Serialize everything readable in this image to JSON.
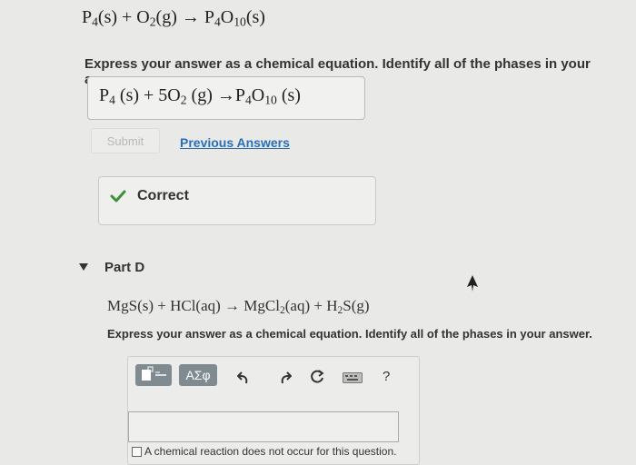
{
  "top_equation": {
    "p4": "P",
    "sub4": "4",
    "rest1": "(s) + O",
    "sub2": "2",
    "rest2": "(g) → P",
    "sub4b": "4",
    "o": "O",
    "sub10": "10",
    "rest3": "(s)"
  },
  "instruction_top": "Express your answer as a chemical equation. Identify all of the phases in your answer.",
  "answer": {
    "a1": "P",
    "s1": "4",
    "a2": " (s) + 5O",
    "s2": "2",
    "a3": " (g) →P",
    "s3": "4",
    "a4": "O",
    "s4": "10",
    "a5": " (s)"
  },
  "submit_label": "Submit",
  "previous_answers_label": "Previous Answers",
  "correct_label": "Correct",
  "part_d_label": "Part D",
  "equation_d": {
    "d1": "MgS(s) + HCl(aq) → MgCl",
    "ds1": "2",
    "d2": "(aq) + H",
    "ds2": "2",
    "d3": "S(g)"
  },
  "instruction_d": "Express your answer as a chemical equation. Identify all of the phases in your answer.",
  "toolbar": {
    "greek_label": "ΑΣφ",
    "help_label": "?"
  },
  "no_reaction_label": "A chemical reaction does not occur for this question.",
  "colors": {
    "accent_link": "#2a6fb5",
    "correct_green": "#3f8f3a",
    "toolbar_button": "#7f8a91"
  },
  "icons": [
    "check-icon",
    "collapse-triangle-icon",
    "template-icon",
    "undo-icon",
    "redo-icon",
    "reset-icon",
    "keyboard-icon",
    "help-icon"
  ]
}
